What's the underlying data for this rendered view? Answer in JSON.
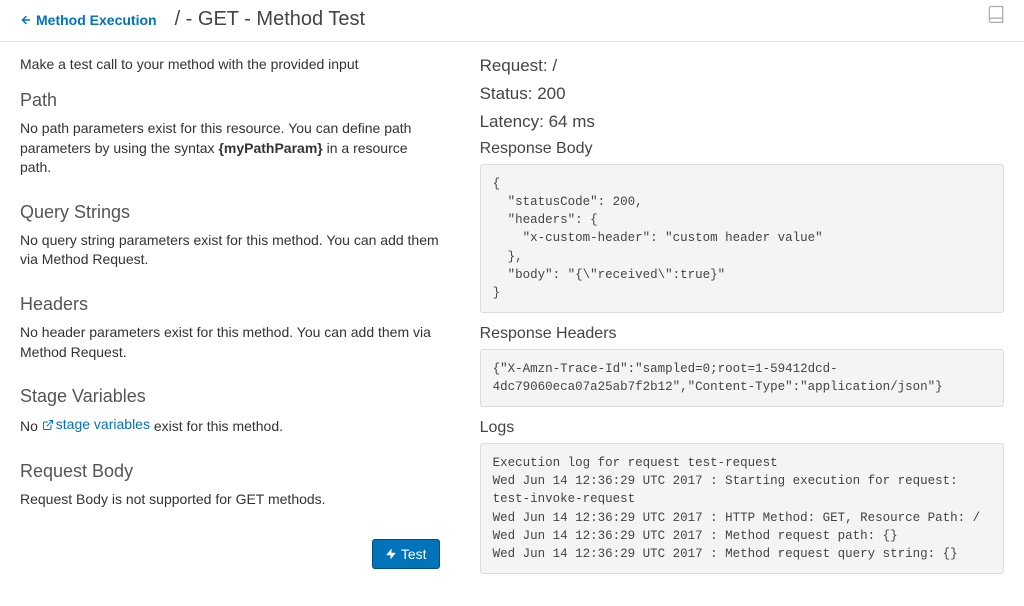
{
  "header": {
    "back_link": "Method Execution",
    "title": "/ - GET - Method Test"
  },
  "intro": "Make a test call to your method with the provided input",
  "left": {
    "path_head": "Path",
    "path_body_prefix": "No path parameters exist for this resource. You can define path parameters by using the syntax ",
    "path_body_bold": "{myPathParam}",
    "path_body_suffix": " in a resource path.",
    "qs_head": "Query Strings",
    "qs_body": "No query string parameters exist for this method. You can add them via Method Request.",
    "headers_head": "Headers",
    "headers_body": "No header parameters exist for this method. You can add them via Method Request.",
    "stage_head": "Stage Variables",
    "stage_prefix": "No ",
    "stage_link": "stage variables",
    "stage_suffix": " exist for this method.",
    "reqbody_head": "Request Body",
    "reqbody_body": "Request Body is not supported for GET methods.",
    "test_label": "Test"
  },
  "right": {
    "request_label": "Request: ",
    "request_value": "/",
    "status_label": "Status: ",
    "status_value": "200",
    "latency_label": "Latency: ",
    "latency_value": "64 ms",
    "response_body_label": "Response Body",
    "response_body": "{\n  \"statusCode\": 200,\n  \"headers\": {\n    \"x-custom-header\": \"custom header value\"\n  },\n  \"body\": \"{\\\"received\\\":true}\"\n}",
    "response_headers_label": "Response Headers",
    "response_headers": "{\"X-Amzn-Trace-Id\":\"sampled=0;root=1-59412dcd-4dc79060eca07a25ab7f2b12\",\"Content-Type\":\"application/json\"}",
    "logs_label": "Logs",
    "logs": "Execution log for request test-request\nWed Jun 14 12:36:29 UTC 2017 : Starting execution for request: test-invoke-request\nWed Jun 14 12:36:29 UTC 2017 : HTTP Method: GET, Resource Path: /\nWed Jun 14 12:36:29 UTC 2017 : Method request path: {}\nWed Jun 14 12:36:29 UTC 2017 : Method request query string: {}"
  }
}
